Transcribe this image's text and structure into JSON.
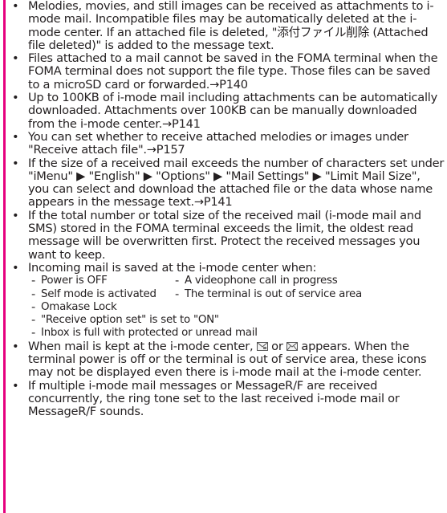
{
  "bullet_char": "•",
  "dash_char": "-",
  "items": [
    {
      "text": "Melodies, movies, and still images can be received as attachments to i-mode mail. Incompatible files may be automatically deleted at the i-mode center. If an attached file is deleted, \"添付ファイル削除 (Attached file deleted)\" is added to the message text."
    },
    {
      "text": "Files attached to a mail cannot be saved in the FOMA terminal when the FOMA terminal does not support the file type. Those files can be saved to a microSD card or forwarded.→P140"
    },
    {
      "text": "Up to 100KB of i-mode mail including attachments can be automatically downloaded. Attachments over 100KB can be manually downloaded from the i-mode center.→P141"
    },
    {
      "text": "You can set whether to receive attached melodies or images under \"Receive attach file\".→P157"
    },
    {
      "text": "If the size of a received mail exceeds the number of characters set under \"iMenu\" ▶ \"English\" ▶ \"Options\" ▶ \"Mail Settings\" ▶ \"Limit Mail Size\", you can select and download the attached file or the data whose name appears in the message text.→P141"
    },
    {
      "text": "If the total number or total size of the received mail (i-mode mail and SMS) stored in the FOMA terminal exceeds the limit, the oldest read message will be overwritten first. Protect the received messages you want to keep."
    },
    {
      "text": "Incoming mail is saved at the i-mode center when:",
      "sub": [
        {
          "col1": "Power is OFF",
          "col2": "A videophone call in progress"
        },
        {
          "col1": "Self mode is activated",
          "col2": "The terminal is out of service area"
        },
        {
          "full": "Omakase Lock"
        },
        {
          "full": "\"Receive option set\" is set to \"ON\""
        },
        {
          "full": "Inbox is full with protected or unread mail"
        }
      ]
    },
    {
      "before": "When mail is kept at the i-mode center, ",
      "middle": " or ",
      "after": " appears. When the terminal power is off or the terminal is out of service area, these icons may not be displayed even there is i-mode mail at the i-mode center.",
      "icons": [
        "imode-mail-waiting-icon",
        "imode-mail-full-icon"
      ]
    },
    {
      "text": "If multiple i-mode mail messages or MessageR/F are received concurrently, the ring tone set to the last received i-mode mail or MessageR/F sounds."
    }
  ]
}
